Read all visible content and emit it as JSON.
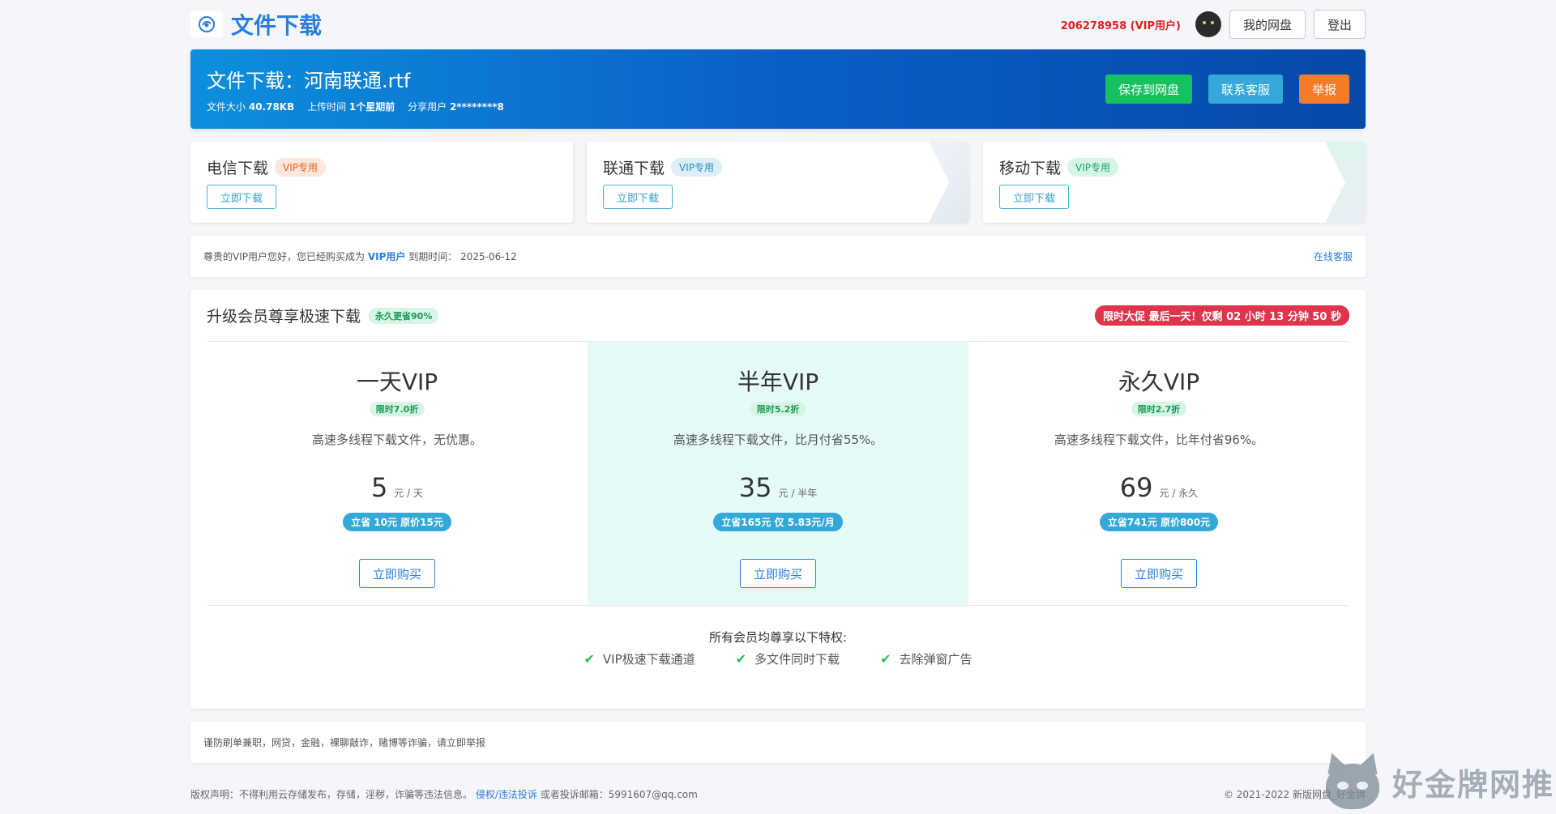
{
  "header": {
    "title": "文件下载",
    "user_id": "206278958 (VIP用户)",
    "my_disk": "我的网盘",
    "logout": "登出"
  },
  "file": {
    "title": "文件下载：河南联通.rtf",
    "size_label": "文件大小",
    "size": "40.78KB",
    "upload_label": "上传时间",
    "upload": "1个星期前",
    "share_label": "分享用户",
    "share": "2********8",
    "save": "保存到网盘",
    "contact": "联系客服",
    "report": "举报"
  },
  "downloads": [
    {
      "title": "电信下载",
      "tag": "VIP专用",
      "button": "立即下载"
    },
    {
      "title": "联通下载",
      "tag": "VIP专用",
      "button": "立即下载"
    },
    {
      "title": "移动下载",
      "tag": "VIP专用",
      "button": "立即下载"
    }
  ],
  "notice": {
    "prefix": "尊贵的VIP用户您好，您已经购买成为",
    "vip": "VIP用户",
    "expire_label": "到期时间：",
    "expire": "2025-06-12",
    "service": "在线客服"
  },
  "plans": {
    "title": "升级会员尊享极速下载",
    "badge": "永久更省90%",
    "promo": "限时大促 最后一天！仅剩 02 小时 13 分钟 50 秒",
    "items": [
      {
        "name": "一天VIP",
        "discount": "限时7.0折",
        "desc": "高速多线程下载文件，无优惠。",
        "price": "5",
        "unit": "元 / 天",
        "save": "立省 10元 原价15元",
        "buy": "立即购买"
      },
      {
        "name": "半年VIP",
        "discount": "限时5.2折",
        "desc": "高速多线程下载文件，比月付省55%。",
        "price": "35",
        "unit": "元 / 半年",
        "save": "立省165元 仅 5.83元/月",
        "buy": "立即购买"
      },
      {
        "name": "永久VIP",
        "discount": "限时2.7折",
        "desc": "高速多线程下载文件，比年付省96%。",
        "price": "69",
        "unit": "元 / 永久",
        "save": "立省741元 原价800元",
        "buy": "立即购买"
      }
    ],
    "perks_title": "所有会员均尊享以下特权:",
    "perks": [
      "VIP极速下载通道",
      "多文件同时下载",
      "去除弹窗广告"
    ]
  },
  "warning": "谨防刷单兼职，网贷，金融，裸聊敲诈，赌博等诈骗，请立即举报",
  "footer": {
    "copyright_prefix": "版权声明：不得利用云存储发布，存储，淫秽，诈骗等违法信息。",
    "link": "侵权/违法投诉",
    "email_text": "或者投诉邮箱：5991607@qq.com",
    "right": "© 2021-2022 新版网盘_好金牌"
  },
  "watermark": "好金牌网推",
  "colors": {
    "brand": "#2a7ee0",
    "green": "#16c25f",
    "cyan": "#33a8d9",
    "orange": "#f47b2a",
    "red": "#e0334e"
  }
}
